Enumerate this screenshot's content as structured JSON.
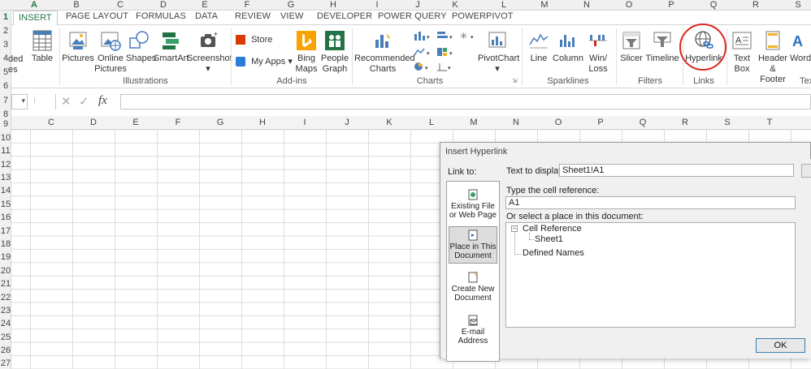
{
  "top_columns": [
    "A",
    "B",
    "C",
    "D",
    "E",
    "F",
    "G",
    "H",
    "I",
    "J",
    "K",
    "L",
    "M",
    "N",
    "O",
    "P",
    "Q",
    "R",
    "S"
  ],
  "top_rows": [
    "1",
    "2",
    "3",
    "4",
    "5",
    "6",
    "7",
    "8",
    "9"
  ],
  "tabs": [
    "INSERT",
    "PAGE LAYOUT",
    "FORMULAS",
    "DATA",
    "REVIEW",
    "VIEW",
    "DEVELOPER",
    "POWER QUERY",
    "POWERPIVOT"
  ],
  "ribbon": {
    "partial_left_top": "ded",
    "partial_left_bottom": "es",
    "table": "Table",
    "pictures": "Pictures",
    "online_pictures_1": "Online",
    "online_pictures_2": "Pictures",
    "shapes": "Shapes",
    "smartart": "SmartArt",
    "screenshot": "Screenshot",
    "store": "Store",
    "my_apps": "My Apps",
    "bing_maps_1": "Bing",
    "bing_maps_2": "Maps",
    "people_graph_1": "People",
    "people_graph_2": "Graph",
    "recommended_charts_1": "Recommended",
    "recommended_charts_2": "Charts",
    "pivotchart": "PivotChart",
    "line": "Line",
    "column": "Column",
    "winloss_1": "Win/",
    "winloss_2": "Loss",
    "slicer": "Slicer",
    "timeline": "Timeline",
    "hyperlink": "Hyperlink",
    "textbox_1": "Text",
    "textbox_2": "Box",
    "header_footer_1": "Header",
    "header_footer_2": "& Footer",
    "wordart": "Word",
    "groups": {
      "illustrations": "Illustrations",
      "addins": "Add-ins",
      "charts": "Charts",
      "sparklines": "Sparklines",
      "filters": "Filters",
      "links": "Links",
      "text": "Tex"
    },
    "accent": "#d9261c"
  },
  "grid_columns": [
    "C",
    "D",
    "E",
    "F",
    "G",
    "H",
    "I",
    "J",
    "K",
    "L",
    "M",
    "N",
    "O",
    "P",
    "Q",
    "R",
    "S",
    "T"
  ],
  "grid_rows": [
    "9",
    "10",
    "11",
    "12",
    "13",
    "14",
    "15",
    "16",
    "17",
    "18",
    "19",
    "20",
    "21",
    "22",
    "23",
    "24",
    "25",
    "26",
    "27"
  ],
  "formula_row_label": "7",
  "formula_row_label2": "8",
  "dialog": {
    "title": "Insert Hyperlink",
    "link_to": "Link to:",
    "existing_file_1": "Existing File",
    "existing_file_2": "or Web Page",
    "place_in_doc_1": "Place in This",
    "place_in_doc_2": "Document",
    "create_new_1": "Create New",
    "create_new_2": "Document",
    "email_1": "E-mail",
    "email_2": "Address",
    "text_to_display_label": "Text to display:",
    "text_to_display_value": "Sheet1!A1",
    "cell_ref_label": "Type the cell reference:",
    "cell_ref_value": "A1",
    "select_place_label": "Or select a place in this document:",
    "tree": {
      "cell_reference": "Cell Reference",
      "sheet1": "Sheet1",
      "defined_names": "Defined Names"
    },
    "ok": "OK"
  }
}
